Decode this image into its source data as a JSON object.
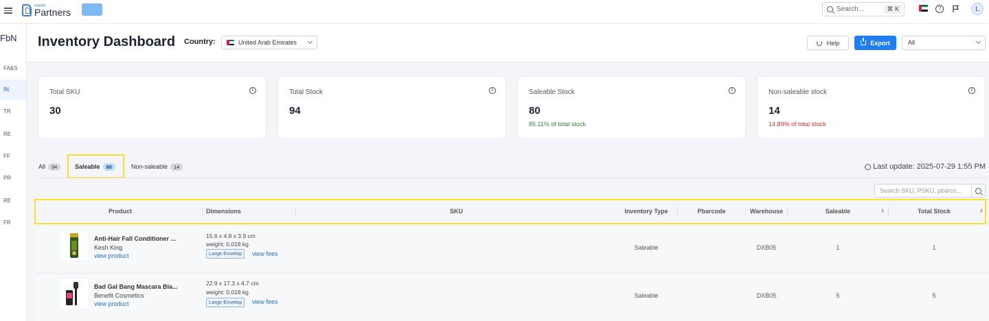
{
  "topbar": {
    "logo_small": "noon",
    "logo_big": "Partners",
    "search_placeholder": "Search...",
    "search_shortcut": "⌘ K",
    "avatar_letter": "L"
  },
  "sidebar": {
    "head": "FbN",
    "items": [
      {
        "label": "FA&S"
      },
      {
        "label": "IN"
      },
      {
        "label": "TR"
      },
      {
        "label": "RE"
      },
      {
        "label": "FF"
      },
      {
        "label": "PR"
      },
      {
        "label": "RE"
      },
      {
        "label": "FR"
      }
    ]
  },
  "header": {
    "title": "Inventory Dashboard",
    "country_label": "Country:",
    "country_value": "United Arab Emirates",
    "help_label": "Help",
    "export_label": "Export",
    "filter_value": "All"
  },
  "cards": [
    {
      "label": "Total SKU",
      "value": "30",
      "sub": ""
    },
    {
      "label": "Total Stock",
      "value": "94",
      "sub": ""
    },
    {
      "label": "Saleable Stock",
      "value": "80",
      "sub": "85.11% of total stock"
    },
    {
      "label": "Non-saleable stock",
      "value": "14",
      "sub": "14.89% of total stock"
    }
  ],
  "colors": {
    "positive": "#2e8b3a",
    "negative": "#d4332e",
    "accent": "#1f7ff2",
    "highlight": "#f7e12b"
  },
  "tabs": [
    {
      "label": "All",
      "count": "94"
    },
    {
      "label": "Saleable",
      "count": "80"
    },
    {
      "label": "Non-saleable",
      "count": "14"
    }
  ],
  "last_update": "Last update: 2025-07-29 1:55 PM",
  "table": {
    "search_placeholder": "Search SKU, PSKU, pbarco...",
    "columns": {
      "product": "Product",
      "dimensions": "Dimensions",
      "sku": "SKU",
      "inventory_type": "Inventory Type",
      "pbarcode": "Pbarcode",
      "warehouse": "Warehouse",
      "saleable": "Saleable",
      "total_stock": "Total Stock"
    },
    "rows": [
      {
        "name": "Anti-Hair Fall Conditioner ...",
        "brand": "Kesh King",
        "view_link": "view product",
        "dimensions": "15.6 x 4.8 x 3.9 cm",
        "weight": "weight: 0.018 kg",
        "envelope": "Large Envelop",
        "fees_link": "view fees",
        "sku": "",
        "inventory_type": "Saleable",
        "pbarcode": "",
        "warehouse": "DXB05",
        "saleable": "1",
        "total_stock": "1"
      },
      {
        "name": "Bad Gal Bang Mascara Bla...",
        "brand": "Benefit Cosmetics",
        "view_link": "view product",
        "dimensions": "22.9 x 17.3 x 4.7 cm",
        "weight": "weight: 0.018 kg",
        "envelope": "Large Envelop",
        "fees_link": "view fees",
        "sku": "",
        "inventory_type": "Saleable",
        "pbarcode": "",
        "warehouse": "DXB05",
        "saleable": "5",
        "total_stock": "5"
      }
    ]
  }
}
